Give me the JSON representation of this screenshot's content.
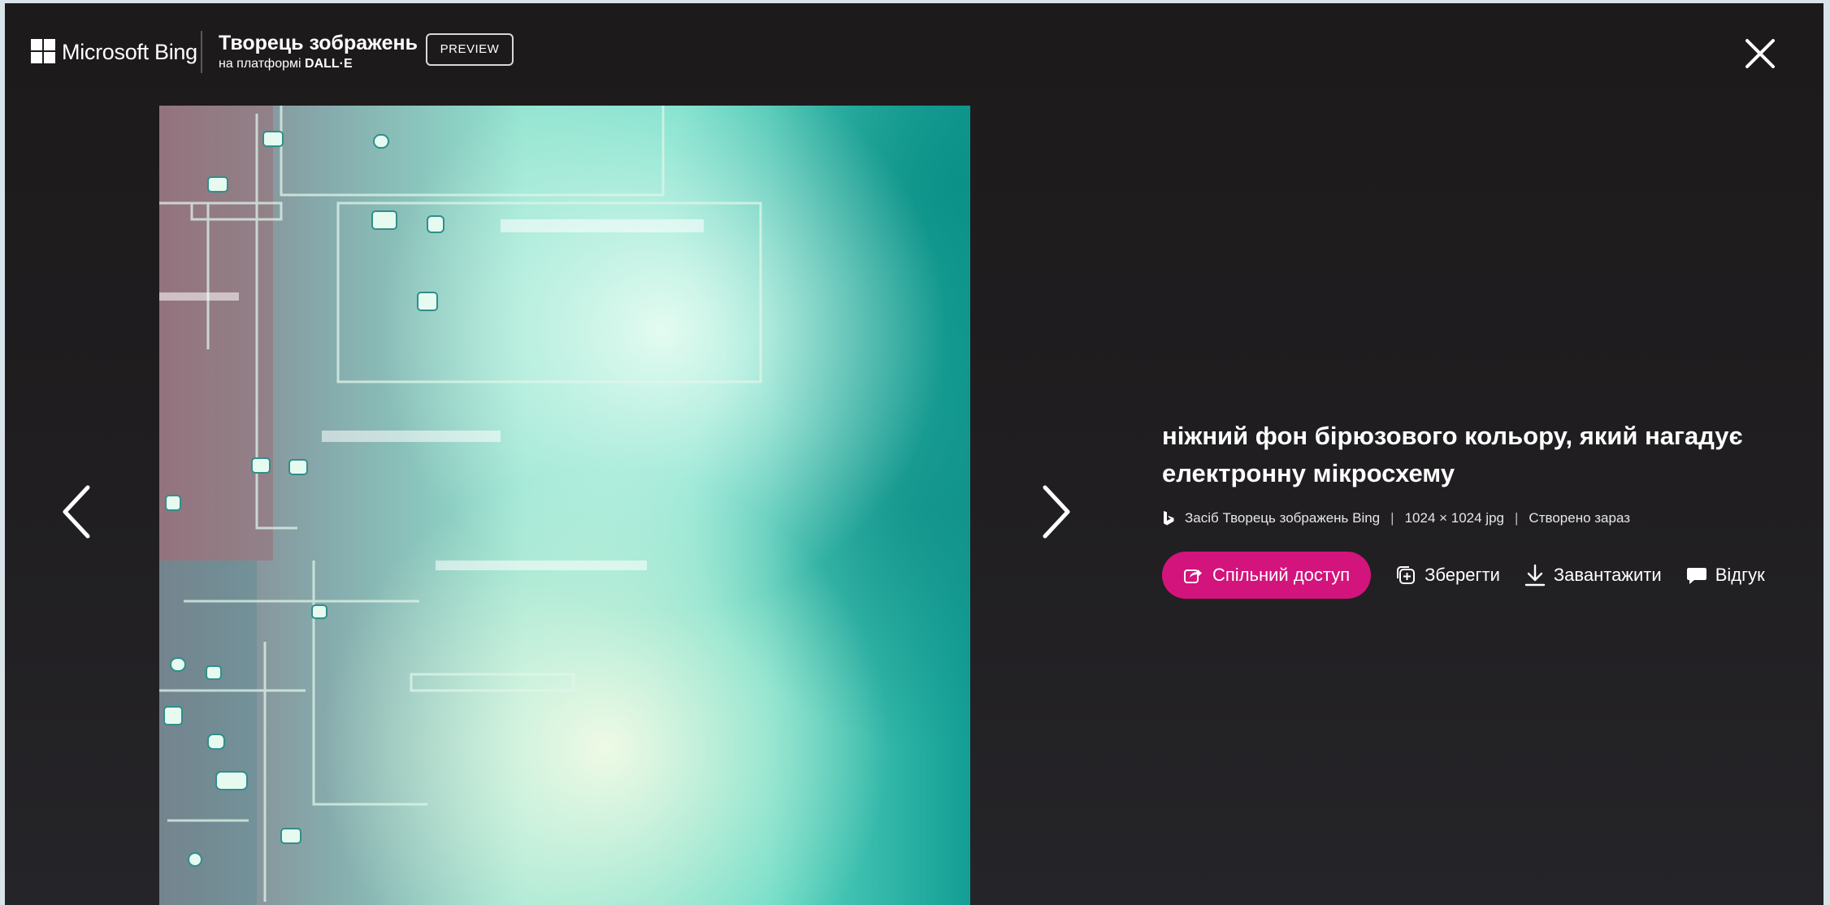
{
  "header": {
    "brand": "Microsoft Bing",
    "product_title": "Творець зображень",
    "product_subtitle_prefix": "на платформі ",
    "product_subtitle_bold": "DALL·E",
    "badge": "PREVIEW"
  },
  "icons": {
    "logo": "microsoft-logo-icon",
    "close": "close-icon",
    "prev": "chevron-left-icon",
    "next": "chevron-right-icon",
    "bing": "bing-b-icon",
    "share": "share-icon",
    "save": "collection-add-icon",
    "download": "download-icon",
    "feedback": "feedback-icon"
  },
  "image": {
    "description_colors": [
      "#5fe3cc",
      "#17b3a4",
      "#8b6a70",
      "#e4f8e8"
    ]
  },
  "details": {
    "prompt": "ніжний фон бірюзового кольору, який нагадує електронну мікросхему",
    "source": "Засіб Творець зображень Bing",
    "size": "1024 × 1024 jpg",
    "created": "Створено зараз",
    "separator": "|"
  },
  "actions": {
    "share": "Спільний доступ",
    "save": "Зберегти",
    "download": "Завантажити",
    "feedback": "Відгук"
  },
  "colors": {
    "accent": "#d3147c",
    "background": "#1f1d1f"
  }
}
